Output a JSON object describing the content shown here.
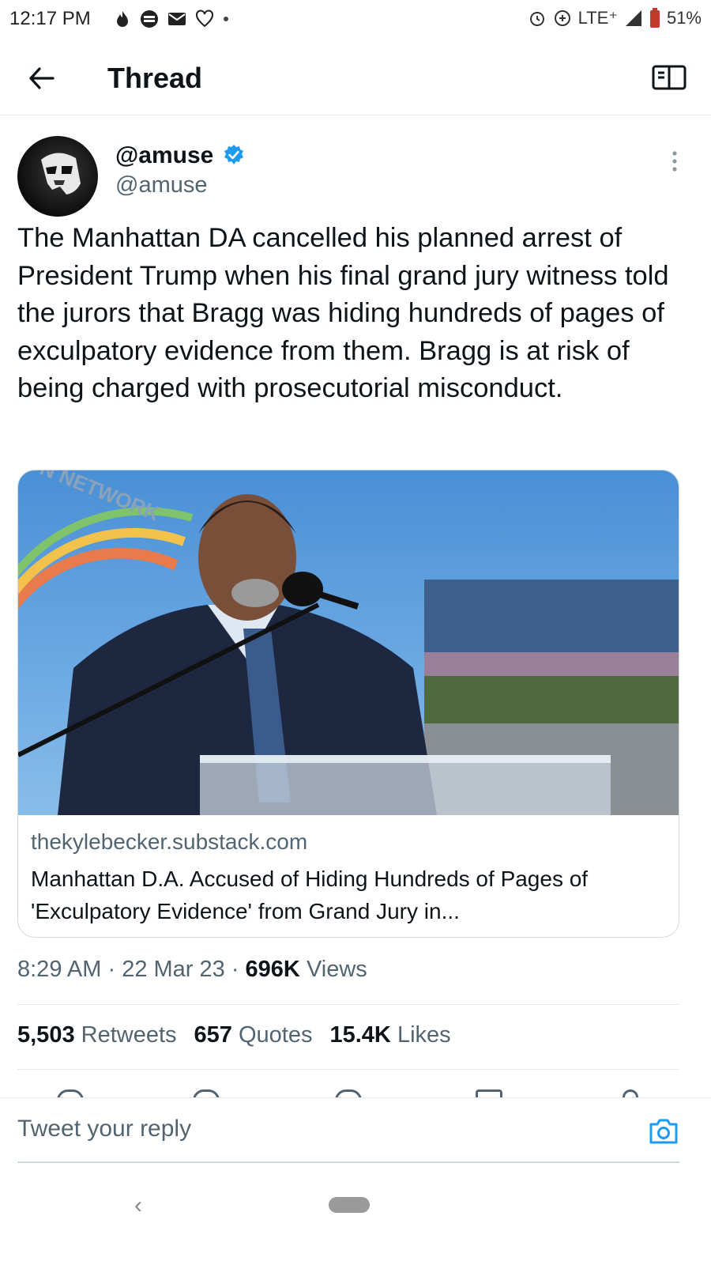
{
  "status_bar": {
    "time": "12:17 PM",
    "network": "LTE⁺",
    "battery": "51%"
  },
  "header": {
    "title": "Thread"
  },
  "tweet": {
    "author_name": "@amuse",
    "author_handle": "@amuse",
    "text": "The Manhattan DA cancelled his planned arrest of President Trump when his final grand jury witness told the jurors that Bragg was hiding hundreds of pages of exculpatory evidence from them. Bragg is at risk of being charged with prosecutorial misconduct.",
    "card": {
      "image_watermark": "ON NETWORK",
      "domain": "thekylebecker.substack.com",
      "title": "Manhattan D.A. Accused of Hiding Hundreds of Pages of 'Exculpatory Evidence' from Grand Jury in..."
    },
    "time": "8:29 AM",
    "date": "22 Mar 23",
    "views_count": "696K",
    "views_label": "Views",
    "stats": {
      "retweets_count": "5,503",
      "retweets_label": "Retweets",
      "quotes_count": "657",
      "quotes_label": "Quotes",
      "likes_count": "15.4K",
      "likes_label": "Likes"
    }
  },
  "reply": {
    "placeholder": "Tweet your reply"
  },
  "colors": {
    "text_primary": "#0f1419",
    "text_secondary": "#536471",
    "accent": "#1d9bf0",
    "divider": "#e6e9eb"
  },
  "icons": {
    "back": "arrow-left-icon",
    "reader": "reader-mode-icon",
    "verified": "verified-badge-icon",
    "more": "more-vertical-icon",
    "camera": "camera-icon"
  }
}
